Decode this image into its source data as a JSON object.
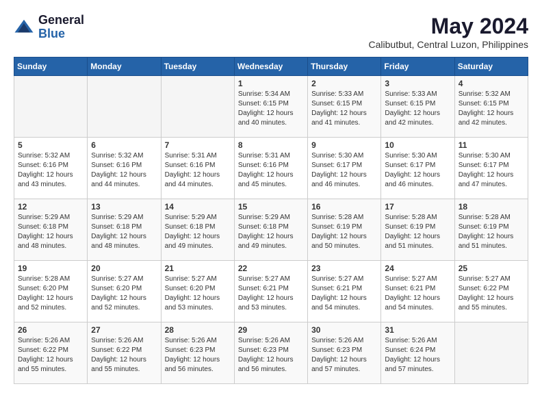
{
  "logo": {
    "line1": "General",
    "line2": "Blue"
  },
  "title": "May 2024",
  "subtitle": "Calibutbut, Central Luzon, Philippines",
  "days_of_week": [
    "Sunday",
    "Monday",
    "Tuesday",
    "Wednesday",
    "Thursday",
    "Friday",
    "Saturday"
  ],
  "weeks": [
    [
      {
        "day": "",
        "info": ""
      },
      {
        "day": "",
        "info": ""
      },
      {
        "day": "",
        "info": ""
      },
      {
        "day": "1",
        "info": "Sunrise: 5:34 AM\nSunset: 6:15 PM\nDaylight: 12 hours\nand 40 minutes."
      },
      {
        "day": "2",
        "info": "Sunrise: 5:33 AM\nSunset: 6:15 PM\nDaylight: 12 hours\nand 41 minutes."
      },
      {
        "day": "3",
        "info": "Sunrise: 5:33 AM\nSunset: 6:15 PM\nDaylight: 12 hours\nand 42 minutes."
      },
      {
        "day": "4",
        "info": "Sunrise: 5:32 AM\nSunset: 6:15 PM\nDaylight: 12 hours\nand 42 minutes."
      }
    ],
    [
      {
        "day": "5",
        "info": "Sunrise: 5:32 AM\nSunset: 6:16 PM\nDaylight: 12 hours\nand 43 minutes."
      },
      {
        "day": "6",
        "info": "Sunrise: 5:32 AM\nSunset: 6:16 PM\nDaylight: 12 hours\nand 44 minutes."
      },
      {
        "day": "7",
        "info": "Sunrise: 5:31 AM\nSunset: 6:16 PM\nDaylight: 12 hours\nand 44 minutes."
      },
      {
        "day": "8",
        "info": "Sunrise: 5:31 AM\nSunset: 6:16 PM\nDaylight: 12 hours\nand 45 minutes."
      },
      {
        "day": "9",
        "info": "Sunrise: 5:30 AM\nSunset: 6:17 PM\nDaylight: 12 hours\nand 46 minutes."
      },
      {
        "day": "10",
        "info": "Sunrise: 5:30 AM\nSunset: 6:17 PM\nDaylight: 12 hours\nand 46 minutes."
      },
      {
        "day": "11",
        "info": "Sunrise: 5:30 AM\nSunset: 6:17 PM\nDaylight: 12 hours\nand 47 minutes."
      }
    ],
    [
      {
        "day": "12",
        "info": "Sunrise: 5:29 AM\nSunset: 6:18 PM\nDaylight: 12 hours\nand 48 minutes."
      },
      {
        "day": "13",
        "info": "Sunrise: 5:29 AM\nSunset: 6:18 PM\nDaylight: 12 hours\nand 48 minutes."
      },
      {
        "day": "14",
        "info": "Sunrise: 5:29 AM\nSunset: 6:18 PM\nDaylight: 12 hours\nand 49 minutes."
      },
      {
        "day": "15",
        "info": "Sunrise: 5:29 AM\nSunset: 6:18 PM\nDaylight: 12 hours\nand 49 minutes."
      },
      {
        "day": "16",
        "info": "Sunrise: 5:28 AM\nSunset: 6:19 PM\nDaylight: 12 hours\nand 50 minutes."
      },
      {
        "day": "17",
        "info": "Sunrise: 5:28 AM\nSunset: 6:19 PM\nDaylight: 12 hours\nand 51 minutes."
      },
      {
        "day": "18",
        "info": "Sunrise: 5:28 AM\nSunset: 6:19 PM\nDaylight: 12 hours\nand 51 minutes."
      }
    ],
    [
      {
        "day": "19",
        "info": "Sunrise: 5:28 AM\nSunset: 6:20 PM\nDaylight: 12 hours\nand 52 minutes."
      },
      {
        "day": "20",
        "info": "Sunrise: 5:27 AM\nSunset: 6:20 PM\nDaylight: 12 hours\nand 52 minutes."
      },
      {
        "day": "21",
        "info": "Sunrise: 5:27 AM\nSunset: 6:20 PM\nDaylight: 12 hours\nand 53 minutes."
      },
      {
        "day": "22",
        "info": "Sunrise: 5:27 AM\nSunset: 6:21 PM\nDaylight: 12 hours\nand 53 minutes."
      },
      {
        "day": "23",
        "info": "Sunrise: 5:27 AM\nSunset: 6:21 PM\nDaylight: 12 hours\nand 54 minutes."
      },
      {
        "day": "24",
        "info": "Sunrise: 5:27 AM\nSunset: 6:21 PM\nDaylight: 12 hours\nand 54 minutes."
      },
      {
        "day": "25",
        "info": "Sunrise: 5:27 AM\nSunset: 6:22 PM\nDaylight: 12 hours\nand 55 minutes."
      }
    ],
    [
      {
        "day": "26",
        "info": "Sunrise: 5:26 AM\nSunset: 6:22 PM\nDaylight: 12 hours\nand 55 minutes."
      },
      {
        "day": "27",
        "info": "Sunrise: 5:26 AM\nSunset: 6:22 PM\nDaylight: 12 hours\nand 55 minutes."
      },
      {
        "day": "28",
        "info": "Sunrise: 5:26 AM\nSunset: 6:23 PM\nDaylight: 12 hours\nand 56 minutes."
      },
      {
        "day": "29",
        "info": "Sunrise: 5:26 AM\nSunset: 6:23 PM\nDaylight: 12 hours\nand 56 minutes."
      },
      {
        "day": "30",
        "info": "Sunrise: 5:26 AM\nSunset: 6:23 PM\nDaylight: 12 hours\nand 57 minutes."
      },
      {
        "day": "31",
        "info": "Sunrise: 5:26 AM\nSunset: 6:24 PM\nDaylight: 12 hours\nand 57 minutes."
      },
      {
        "day": "",
        "info": ""
      }
    ]
  ]
}
